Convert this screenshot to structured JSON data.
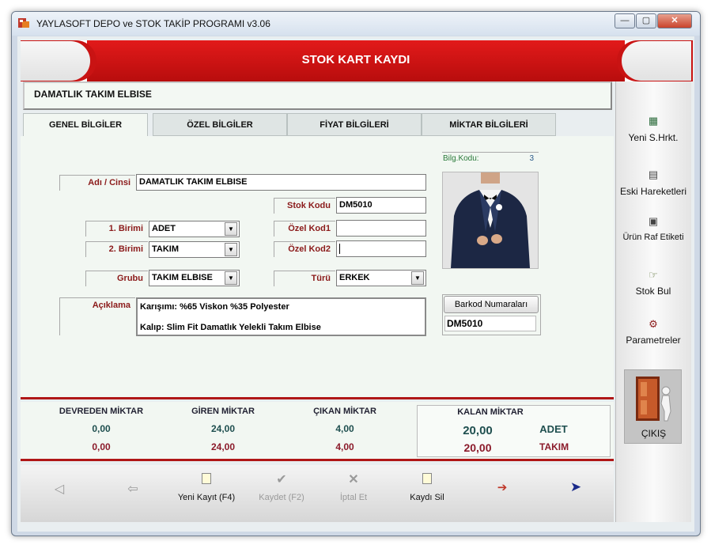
{
  "window": {
    "title": "YAYLASOFT DEPO ve STOK TAKİP PROGRAMI v3.06",
    "controls": {
      "minimize": "—",
      "maximize": "▢",
      "close": "✕"
    }
  },
  "header": {
    "title": "STOK KART KAYDI"
  },
  "name_bar": {
    "value": "DAMATLIK TAKIM ELBISE"
  },
  "tabs": [
    {
      "label": "GENEL BİLGİLER"
    },
    {
      "label": "ÖZEL BİLGİLER"
    },
    {
      "label": "FİYAT BİLGİLERİ"
    },
    {
      "label": "MİKTAR BİLGİLERİ"
    }
  ],
  "form": {
    "adi": {
      "label": "Adı / Cinsi",
      "value": "DAMATLIK TAKIM ELBISE"
    },
    "stok_kodu": {
      "label": "Stok Kodu",
      "value": "DM5010"
    },
    "birim1": {
      "label": "1. Birimi",
      "value": "ADET"
    },
    "ozel_kod1": {
      "label": "Özel Kod1",
      "value": ""
    },
    "birim2": {
      "label": "2. Birimi",
      "value": "TAKIM"
    },
    "ozel_kod2": {
      "label": "Özel Kod2",
      "value": ""
    },
    "grubu": {
      "label": "Grubu",
      "value": "TAKIM ELBISE"
    },
    "turu": {
      "label": "Türü",
      "value": "ERKEK"
    },
    "aciklama": {
      "label": "Açıklama",
      "line1": "Karışımı: %65 Viskon %35 Polyester",
      "line2": "Kalıp: Slim Fit Damatlık Yelekli Takım Elbise"
    },
    "bilg_kodu": {
      "label": "Bilg.Kodu:",
      "value": "3"
    },
    "barkod": {
      "button": "Barkod Numaraları",
      "value": "DM5010"
    }
  },
  "summary": {
    "devreden": {
      "label": "DEVREDEN MİKTAR",
      "v1": "0,00",
      "v2": "0,00"
    },
    "giren": {
      "label": "GİREN MİKTAR",
      "v1": "24,00",
      "v2": "24,00"
    },
    "cikan": {
      "label": "ÇIKAN MİKTAR",
      "v1": "4,00",
      "v2": "4,00"
    },
    "kalan": {
      "label": "KALAN MİKTAR",
      "v1": "20,00",
      "u1": "ADET",
      "v2": "20,00",
      "u2": "TAKIM"
    }
  },
  "toolbar": {
    "first": "◁",
    "prev": "⇦",
    "new_label": "Yeni Kayıt (F4)",
    "save_label": "Kaydet (F2)",
    "cancel_label": "İptal Et",
    "delete_label": "Kaydı Sil",
    "next": "➔",
    "last": "➤"
  },
  "right_panel": {
    "yeni_hrkt": "Yeni S.Hrkt.",
    "eski": "Eski Hareketleri",
    "raf": "Ürün Raf Etiketi",
    "stok_bul": "Stok Bul",
    "param": "Parametreler",
    "cikis": "ÇIKIŞ"
  },
  "colors": {
    "header_red": "#d21414",
    "label_red": "#8b1a1a",
    "value_green": "#1f4f4f",
    "value_red": "#8b1a2a",
    "panel_bg": "#f2f7f2"
  }
}
